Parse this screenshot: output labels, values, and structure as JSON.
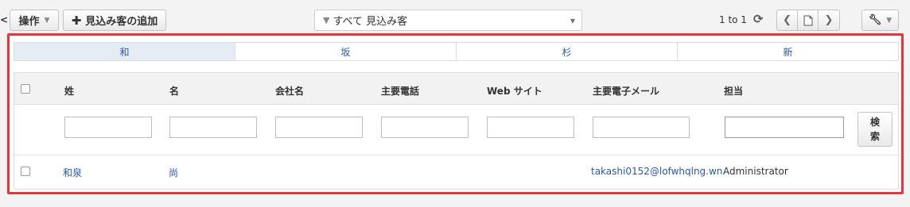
{
  "toolbar": {
    "left_edge_glyph": "<",
    "actions_label": "操作",
    "add_lead_label": "見込み客の追加",
    "filter_value": "すべて 見込み客",
    "pager_text": "1 to 1"
  },
  "alpha_tabs": [
    "和",
    "坂",
    "杉",
    "新"
  ],
  "table": {
    "headers": {
      "last_name": "姓",
      "first_name": "名",
      "company": "会社名",
      "phone": "主要電話",
      "website": "Web サイト",
      "email": "主要電子メール",
      "owner": "担当"
    },
    "search_label_1": "検",
    "search_label_2": "索",
    "rows": [
      {
        "last_name": "和泉",
        "first_name": "尚",
        "company": "",
        "phone": "",
        "website": "",
        "email": "takashi0152@lofwhqlng.wn",
        "owner": "Administrator"
      }
    ]
  },
  "colors": {
    "highlight_border": "#e8343c",
    "link": "#2a59a8"
  }
}
